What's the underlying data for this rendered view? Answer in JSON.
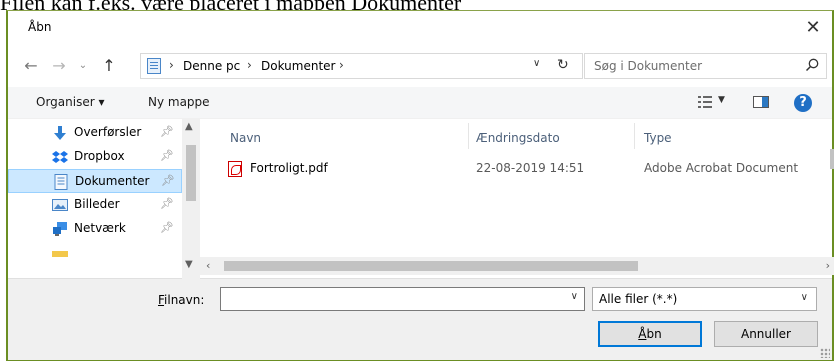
{
  "doc_text": "Filen kan f.eks. være placeret i mappen Dokumenter",
  "dialog": {
    "title": "Åbn",
    "close_icon": "close-icon"
  },
  "navigation": {
    "breadcrumbs": [
      "Denne pc",
      "Dokumenter"
    ],
    "search_placeholder": "Søg i Dokumenter"
  },
  "toolbar": {
    "organise_label": "Organiser ▾",
    "new_folder_label": "Ny mappe"
  },
  "sidebar": {
    "items": [
      {
        "label": "Overførsler",
        "icon": "download-arrow-icon",
        "selected": false
      },
      {
        "label": "Dropbox",
        "icon": "dropbox-icon",
        "selected": false
      },
      {
        "label": "Dokumenter",
        "icon": "documents-icon",
        "selected": true
      },
      {
        "label": "Billeder",
        "icon": "pictures-icon",
        "selected": false
      },
      {
        "label": "Netværk",
        "icon": "network-icon",
        "selected": false
      }
    ]
  },
  "file_list": {
    "columns": [
      "Navn",
      "Ændringsdato",
      "Type"
    ],
    "rows": [
      {
        "name": "Fortroligt.pdf",
        "date": "22-08-2019 14:51",
        "type": "Adobe Acrobat Document",
        "icon": "pdf-file-icon"
      }
    ]
  },
  "footer": {
    "filename_label_prefix": "F",
    "filename_label_rest": "ilnavn:",
    "filename_value": "",
    "filter_value": "Alle filer (*.*)",
    "open_label_prefix": "Å",
    "open_label_rest": "bn",
    "cancel_label": "Annuller"
  },
  "colors": {
    "accent": "#0078d7",
    "selected_bg": "#cce8ff",
    "window_border": "#6b8e23"
  }
}
